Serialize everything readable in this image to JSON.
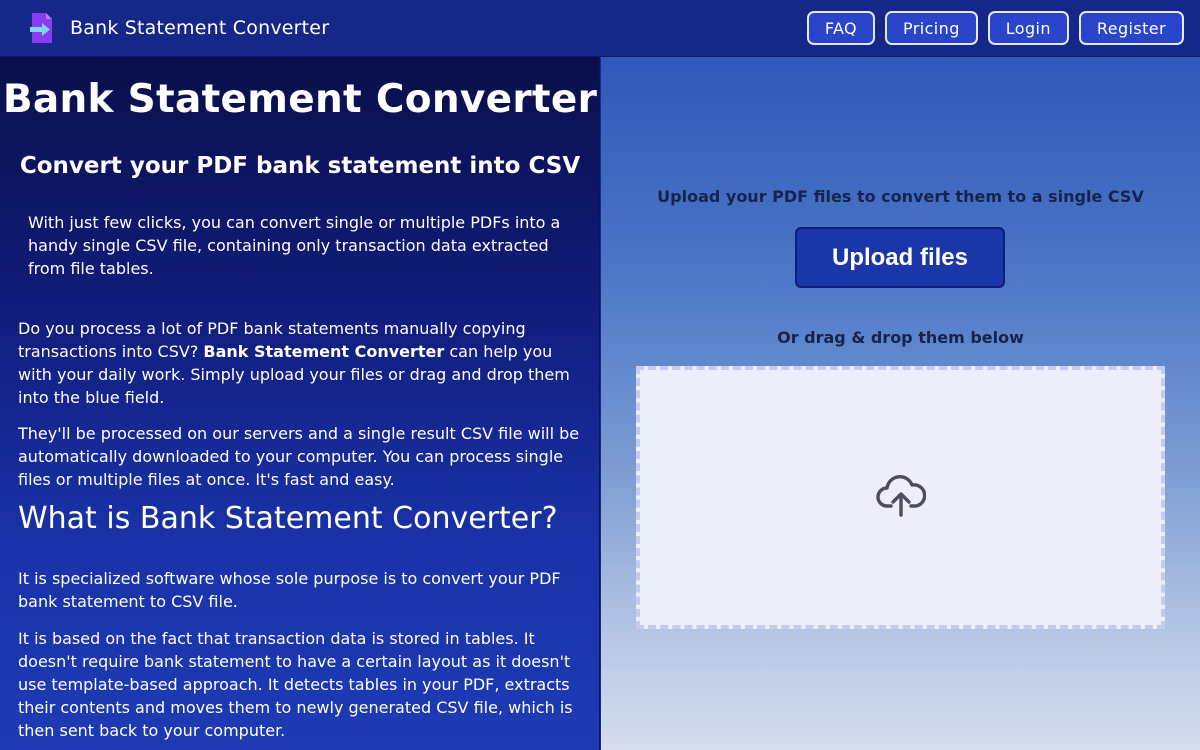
{
  "navbar": {
    "brand": "Bank Statement Converter",
    "logo_icon": "document-arrow-icon",
    "buttons": [
      "FAQ",
      "Pricing",
      "Login",
      "Register"
    ]
  },
  "left": {
    "title": "Bank Statement Converter",
    "subtitle": "Convert your PDF bank statement into CSV",
    "intro": "With just few clicks, you can convert single or multiple PDFs into a handy single CSV file, containing only transaction data extracted from file tables.",
    "p1_before": "Do you process a lot of PDF bank statements manually copying transactions into CSV? ",
    "p1_bold": "Bank Statement Converter",
    "p1_after": " can help you with your daily work. Simply upload your files or drag and drop them into the blue field.",
    "p2": "They'll be processed on our servers and a single result CSV file will be automatically downloaded to your computer. You can process single files or multiple files at once. It's fast and easy.",
    "heading": "What is Bank Statement Converter?",
    "p3": "It is specialized software whose sole purpose is to convert your PDF bank statement to CSV file.",
    "p4": "It is based on the fact that transaction data is stored in tables. It doesn't require bank statement to have a certain layout as it doesn't use template-based approach. It detects tables in your PDF, extracts their contents and moves them to newly generated CSV file, which is then sent back to your computer."
  },
  "upload": {
    "hint": "Upload your PDF files to convert them to a single CSV",
    "button": "Upload files",
    "drag_hint": "Or drag & drop them below",
    "dropzone_icon": "cloud-upload-icon"
  },
  "colors": {
    "navbar": "#16278a",
    "nav_button": "#2a45c9",
    "upload_button": "#1b36a8",
    "dropzone": "#eceefa"
  }
}
